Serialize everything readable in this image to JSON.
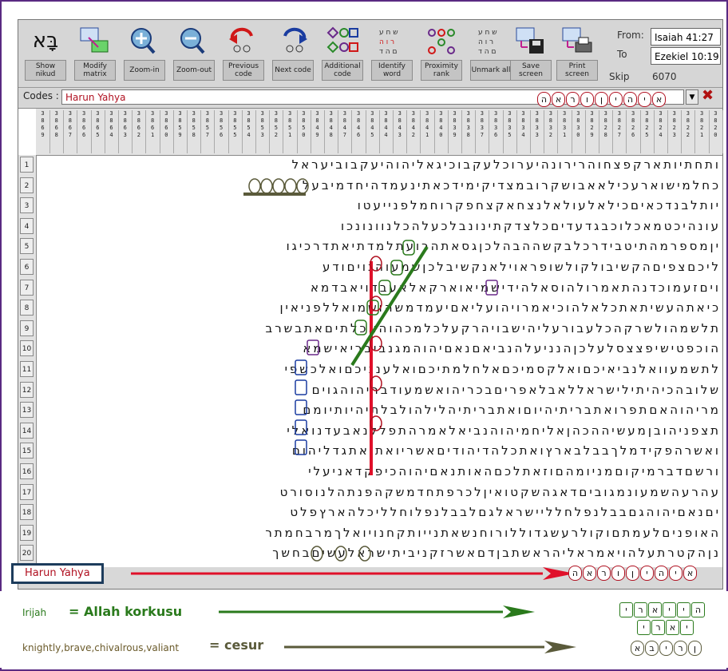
{
  "toolbar": {
    "buttons": [
      {
        "id": "show-nikud",
        "label": "Show nikud",
        "icon": "aleph-bet-icon"
      },
      {
        "id": "modify-matrix",
        "label": "Modify matrix",
        "icon": "grid-arrow-icon"
      },
      {
        "id": "zoom-in",
        "label": "Zoom-in",
        "icon": "zoom-in-icon"
      },
      {
        "id": "zoom-out",
        "label": "Zoom-out",
        "icon": "zoom-out-icon"
      },
      {
        "id": "previous-code",
        "label": "Previous code",
        "icon": "previous-code-icon"
      },
      {
        "id": "next-code",
        "label": "Next code",
        "icon": "next-code-icon"
      },
      {
        "id": "additional-code",
        "label": "Additional code",
        "icon": "additional-code-icon"
      },
      {
        "id": "identify-word",
        "label": "Identify word",
        "icon": "identify-word-icon"
      },
      {
        "id": "proximity-rank",
        "label": "Proximity rank",
        "icon": "proximity-rank-icon"
      },
      {
        "id": "unmark-all",
        "label": "Unmark all",
        "icon": "unmark-all-icon"
      },
      {
        "id": "save-screen",
        "label": "Save screen",
        "icon": "save-screen-icon"
      },
      {
        "id": "print-screen",
        "label": "Print screen",
        "icon": "print-screen-icon"
      }
    ],
    "from_label": "From:",
    "from_value": "Isaiah 41:27",
    "to_label": "To",
    "to_value": "Ezekiel 10:19",
    "skip_label": "Skip",
    "skip_value": "6070"
  },
  "codes": {
    "label": "Codes :",
    "value": "Harun Yahya",
    "hebrew_code": "הארוןיהיא"
  },
  "matrix": {
    "column_headers": [
      "3\n8\n6\n9",
      "3\n8\n6\n8",
      "3\n8\n6\n7",
      "3\n8\n6\n6",
      "3\n8\n6\n5",
      "3\n8\n6\n4",
      "3\n8\n6\n3",
      "3\n8\n6\n2",
      "3\n8\n6\n1",
      "3\n8\n6\n0",
      "3\n8\n5\n9",
      "3\n8\n5\n8",
      "3\n8\n5\n7",
      "3\n8\n5\n6",
      "3\n8\n5\n5",
      "3\n8\n5\n4",
      "3\n8\n5\n3",
      "3\n8\n5\n2",
      "3\n8\n5\n1",
      "3\n8\n5\n0",
      "3\n8\n4\n9",
      "3\n8\n4\n8",
      "3\n8\n4\n7",
      "3\n8\n4\n6",
      "3\n8\n4\n5",
      "3\n8\n4\n4",
      "3\n8\n4\n3",
      "3\n8\n4\n2",
      "3\n8\n4\n1",
      "3\n8\n4\n0",
      "3\n8\n3\n9",
      "3\n8\n3\n8",
      "3\n8\n3\n7",
      "3\n8\n3\n6",
      "3\n8\n3\n5",
      "3\n8\n3\n4",
      "3\n8\n3\n3",
      "3\n8\n3\n2",
      "3\n8\n3\n1",
      "3\n8\n3\n0",
      "3\n8\n2\n9",
      "3\n8\n2\n8",
      "3\n8\n2\n7",
      "3\n8\n2\n6",
      "3\n8\n2\n5",
      "3\n8\n2\n4",
      "3\n8\n2\n3",
      "3\n8\n2\n2",
      "3\n8\n2\n1",
      "3\n8\n2\n0"
    ],
    "rows": [
      {
        "n": "1",
        "text": "ותחתיותארקפצחוהרירונהיערוכלעקבוכיגאליהוהיעקבוביעראל"
      },
      {
        "n": "2",
        "text": "כחלמישוארעכילאאבושקרובמצדיקימידכאתינעמדהיחדמיבעל"
      },
      {
        "n": "3",
        "text": "יותלבנדכאיםכילאלעולאלנצחאקצחפקרוחמלפנייעטו"
      },
      {
        "n": "4",
        "text": "עונהיכטמאכלוכבגדעדיםכלצדקתינונבלכעלהכלנוונונכו"
      },
      {
        "n": "5",
        "text": "יןמספרמהתיטבידרכלבקשההבהלכןגסאתהרועתלמדתיאתדרכיגו"
      },
      {
        "n": "6",
        "text": "ליכםצפיםהקשיבולקולשופראוילאנקשיבלכןשמעוהגויםודע"
      },
      {
        "n": "7",
        "text": "ויםזעמוכדנהתאמרולהוסאלהידישמיאוארקאלאעבדויאבדמא"
      },
      {
        "n": "8",
        "text": "כיאתהעשיתאתכלאלהוכיאמרויהועליאםיעמדמשהושמואללפניאין"
      },
      {
        "n": "9",
        "text": "תלשמהולשרקהכלעבורעליהישבויהרקעלכלמכהוהאכלתיםאתבשרב"
      },
      {
        "n": "10",
        "text": "הוכפטישיפצצסלעלכןהנניעלהנביאםנאםיהוהמגנביבריאישמא"
      },
      {
        "n": "11",
        "text": "לתשמעוואלנביאיכםואלקסמיכםאלחלמתיכםואלענניכםואלכשפי"
      },
      {
        "n": "12",
        "text": "שלובהכיהיתילישראללאבלאפריםבכריהואשמעודבריהוהגוים"
      },
      {
        "n": "13",
        "text": "מריהוהאםתפרואתבריתיהיוםואתבריתיהלילהולבלתיהיותיומם"
      },
      {
        "n": "14",
        "text": "תצפניהובןמעשיההכהןאליחמיהוהנביאלאמרהתפללנאבעדנואלי"
      },
      {
        "n": "15",
        "text": "ואשרהפקידמלךבבלבארץואתכלהדיהודיםאשריואתואתגדליהום"
      },
      {
        "n": "16",
        "text": "ורשםדברמיקוםמניומהםוזאתלכםהאותנאםיהוהכיפקדאניעלי"
      },
      {
        "n": "17",
        "text": "עהרעהשמעונמגוביםדאגהשקטואיןלכרפתחדמשקהפנתהלנוסורט"
      },
      {
        "n": "18",
        "text": "יםנאםיהוהגםבבלנפלחלליישראלגםלבבלנפלוחלליכלהארץפלט"
      },
      {
        "n": "19",
        "text": "האופניםלעמתםוקולרעשגדוללורוחנשאתנייותקחנויואלךמרבחמתר"
      },
      {
        "n": "20",
        "text": "נןהקטרתעלהויאמראליהראשתבןדםאשרזקניביתישראלעשיםבחשך"
      }
    ]
  },
  "footer": {
    "code_box": "Harun Yahya",
    "legend": [
      {
        "label": "Irijah",
        "meaning": "= Allah korkusu",
        "hebrew": "יראייה",
        "color": "#2a7a1c"
      },
      {
        "label": "knightly,brave,chivalrous,valiant",
        "meaning": "= cesur",
        "hebrew": "אבירן",
        "color": "#5a5a3a"
      }
    ]
  },
  "colors": {
    "frame": "#5a2a82",
    "red_line": "#e0102a",
    "green_line": "#2a7a1c",
    "olive_line": "#5a5a3a",
    "code_red": "#b01020"
  }
}
